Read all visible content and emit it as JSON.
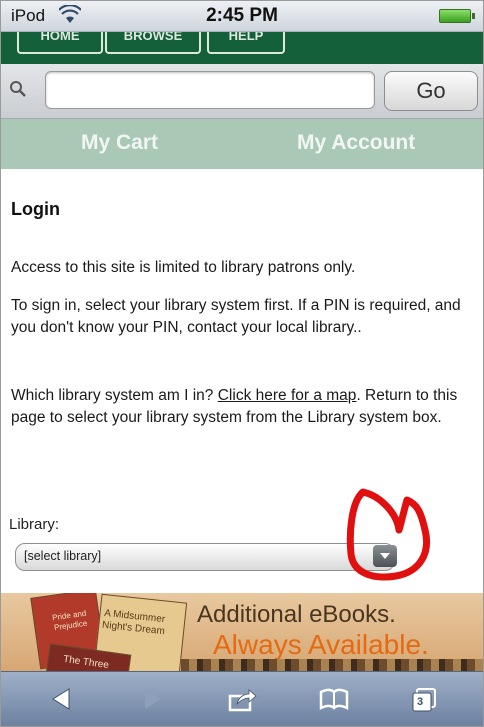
{
  "status": {
    "carrier": "iPod",
    "time": "2:45 PM"
  },
  "topnav": {
    "buttons": [
      "HOME",
      "BROWSE",
      "HELP"
    ]
  },
  "search": {
    "value": "",
    "go_label": "Go"
  },
  "account_bar": {
    "cart": "My Cart",
    "account": "My Account"
  },
  "content": {
    "title": "Login",
    "p1": "Access to this site is limited to library patrons only.",
    "p2": "To sign in, select your library system first. If a PIN is required, and you don't know your PIN, contact your local library..",
    "p3_before": "Which library system am I in?",
    "p3_link": "Click here for a map",
    "p3_after": ". Return to this page to select your library system from the Library system box.",
    "library_label": "Library:",
    "library_select": "[select library]"
  },
  "banner": {
    "line1": "Additional eBooks.",
    "line2": "Always Available.",
    "book1": "Pride and Prejudice",
    "book2": "A Midsummer Night's Dream",
    "book3": "The Three"
  },
  "toolbar": {
    "tabs_count": "3"
  },
  "colors": {
    "nav_green": "#13603a",
    "account_bar": "#a9c8b6",
    "annotation_red": "#e01010",
    "banner_orange": "#e56a12"
  }
}
